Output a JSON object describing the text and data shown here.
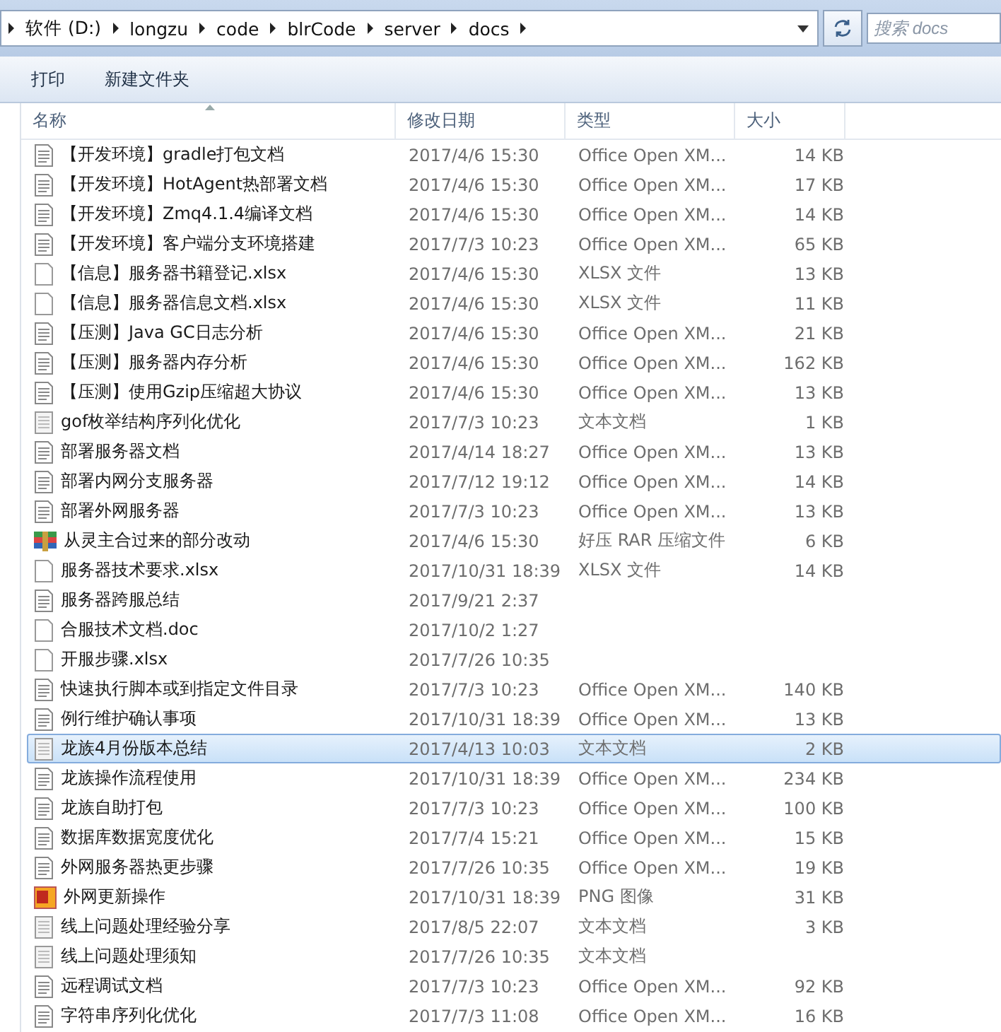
{
  "address_bar": {
    "segments": [
      "软件 (D:)",
      "longzu",
      "code",
      "blrCode",
      "server",
      "docs"
    ]
  },
  "search": {
    "placeholder": "搜索 docs"
  },
  "toolbar": {
    "buttons": [
      "打印",
      "新建文件夹"
    ]
  },
  "table": {
    "columns": [
      "名称",
      "修改日期",
      "类型",
      "大小"
    ],
    "rows": [
      {
        "kind": "doc",
        "name": "【开发环境】gradle打包文档",
        "date": "2017/4/6 15:30",
        "type": "Office Open XM...",
        "size": "14 KB",
        "selected": false
      },
      {
        "kind": "doc",
        "name": "【开发环境】HotAgent热部署文档",
        "date": "2017/4/6 15:30",
        "type": "Office Open XM...",
        "size": "17 KB",
        "selected": false
      },
      {
        "kind": "doc",
        "name": "【开发环境】Zmq4.1.4编译文档",
        "date": "2017/4/6 15:30",
        "type": "Office Open XM...",
        "size": "14 KB",
        "selected": false
      },
      {
        "kind": "doc",
        "name": "【开发环境】客户端分支环境搭建",
        "date": "2017/7/3 10:23",
        "type": "Office Open XM...",
        "size": "65 KB",
        "selected": false
      },
      {
        "kind": "blank",
        "name": "【信息】服务器书籍登记.xlsx",
        "date": "2017/4/6 15:30",
        "type": "XLSX 文件",
        "size": "13 KB",
        "selected": false
      },
      {
        "kind": "blank",
        "name": "【信息】服务器信息文档.xlsx",
        "date": "2017/4/6 15:30",
        "type": "XLSX 文件",
        "size": "11 KB",
        "selected": false
      },
      {
        "kind": "doc",
        "name": "【压测】Java GC日志分析",
        "date": "2017/4/6 15:30",
        "type": "Office Open XM...",
        "size": "21 KB",
        "selected": false
      },
      {
        "kind": "doc",
        "name": "【压测】服务器内存分析",
        "date": "2017/4/6 15:30",
        "type": "Office Open XM...",
        "size": "162 KB",
        "selected": false
      },
      {
        "kind": "doc",
        "name": "【压测】使用Gzip压缩超大协议",
        "date": "2017/4/6 15:30",
        "type": "Office Open XM...",
        "size": "13 KB",
        "selected": false
      },
      {
        "kind": "text",
        "name": "gof枚举结构序列化优化",
        "date": "2017/7/3 10:23",
        "type": "文本文档",
        "size": "1 KB",
        "selected": false
      },
      {
        "kind": "doc",
        "name": "部署服务器文档",
        "date": "2017/4/14 18:27",
        "type": "Office Open XM...",
        "size": "13 KB",
        "selected": false
      },
      {
        "kind": "doc",
        "name": "部署内网分支服务器",
        "date": "2017/7/12 19:12",
        "type": "Office Open XM...",
        "size": "14 KB",
        "selected": false
      },
      {
        "kind": "doc",
        "name": "部署外网服务器",
        "date": "2017/7/3 10:23",
        "type": "Office Open XM...",
        "size": "13 KB",
        "selected": false
      },
      {
        "kind": "rar",
        "name": "从灵主合过来的部分改动",
        "date": "2017/4/6 15:30",
        "type": "好压 RAR 压缩文件",
        "size": "6 KB",
        "selected": false
      },
      {
        "kind": "blank",
        "name": "服务器技术要求.xlsx",
        "date": "2017/10/31 18:39",
        "type": "XLSX 文件",
        "size": "14 KB",
        "selected": false
      },
      {
        "kind": "doc",
        "name": "服务器跨服总结",
        "date": "2017/9/21 2:37",
        "selected": false
      },
      {
        "kind": "blank",
        "name": "合服技术文档.doc",
        "date": "2017/10/2 1:27",
        "selected": false
      },
      {
        "kind": "blank",
        "name": "开服步骤.xlsx",
        "date": "2017/7/26 10:35",
        "selected": false
      },
      {
        "kind": "doc",
        "name": "快速执行脚本或到指定文件目录",
        "date": "2017/7/3 10:23",
        "type": "Office Open XM...",
        "size": "140 KB",
        "selected": false
      },
      {
        "kind": "doc",
        "name": "例行维护确认事项",
        "date": "2017/10/31 18:39",
        "type": "Office Open XM...",
        "size": "13 KB",
        "selected": false
      },
      {
        "kind": "text",
        "name": "龙族4月份版本总结",
        "date": "2017/4/13 10:03",
        "type": "文本文档",
        "size": "2 KB",
        "selected": true
      },
      {
        "kind": "doc",
        "name": "龙族操作流程使用",
        "date": "2017/10/31 18:39",
        "type": "Office Open XM...",
        "size": "234 KB",
        "selected": false
      },
      {
        "kind": "doc",
        "name": "龙族自助打包",
        "date": "2017/7/3 10:23",
        "type": "Office Open XM...",
        "size": "100 KB",
        "selected": false
      },
      {
        "kind": "doc",
        "name": "数据库数据宽度优化",
        "date": "2017/7/4 15:21",
        "type": "Office Open XM...",
        "size": "15 KB",
        "selected": false
      },
      {
        "kind": "doc",
        "name": "外网服务器热更步骤",
        "date": "2017/7/26 10:35",
        "type": "Office Open XM...",
        "size": "19 KB",
        "selected": false
      },
      {
        "kind": "png",
        "name": "外网更新操作",
        "date": "2017/10/31 18:39",
        "type": "PNG 图像",
        "size": "31 KB",
        "selected": false
      },
      {
        "kind": "text",
        "name": "线上问题处理经验分享",
        "date": "2017/8/5 22:07",
        "type": "文本文档",
        "size": "3 KB",
        "selected": false
      },
      {
        "kind": "text",
        "name": "线上问题处理须知",
        "date": "2017/7/26 10:35",
        "type": "文本文档",
        "selected": false
      },
      {
        "kind": "doc",
        "name": "远程调试文档",
        "date": "2017/7/3 10:23",
        "type": "Office Open XM...",
        "size": "92 KB",
        "selected": false
      },
      {
        "kind": "doc",
        "name": "字符串序列化优化",
        "date": "2017/7/3 11:08",
        "type": "Office Open XM...",
        "size": "16 KB",
        "selected": false
      }
    ]
  }
}
